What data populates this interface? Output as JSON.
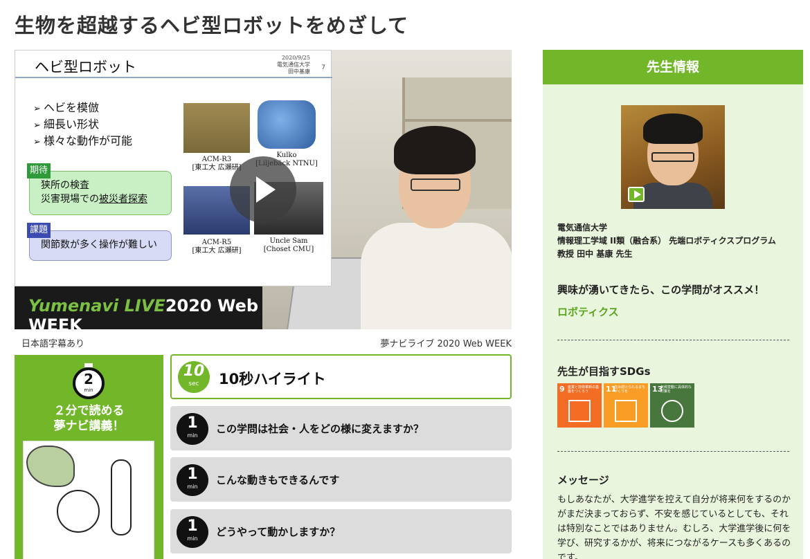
{
  "page": {
    "title": "生物を超越するヘビ型ロボットをめざして"
  },
  "video": {
    "slide": {
      "title": "ヘビ型ロボット",
      "date": "2020/9/25",
      "university": "電気通信大学",
      "author": "田中基康",
      "page_number": "7",
      "bullets": [
        "ヘビを模倣",
        "細長い形状",
        "様々な動作が可能"
      ],
      "expect_tag": "期待",
      "expect_lines": [
        "狭所の検査",
        "災害現場での",
        "被災者探索"
      ],
      "issue_tag": "課題",
      "issue_line": "関節数が多く操作が難しい",
      "robots": [
        {
          "name": "ACM-R3",
          "lab": "[東工大 広瀬研]"
        },
        {
          "name": "Kulko",
          "lab": "[Liljebäck NTNU]"
        },
        {
          "name": "ACM-R5",
          "lab": "[東工大 広瀬研]"
        },
        {
          "name": "Uncle Sam",
          "lab": "[Choset CMU]"
        }
      ]
    },
    "brand": {
      "prefix": "Yumenavi",
      "live": "LIVE",
      "year": "2020",
      "suffix": "Web WEEK"
    },
    "subtitle_note": "日本語字幕あり",
    "week_note": "夢ナビライブ 2020 Web WEEK"
  },
  "two_min": {
    "number": "2",
    "unit": "min",
    "line1": "２分で読める",
    "line2": "夢ナビ講義！"
  },
  "highlight": {
    "badge_number": "10",
    "badge_unit": "sec",
    "label": "10秒ハイライト"
  },
  "one_min_cards": [
    {
      "number": "1",
      "unit": "min",
      "label": "この学問は社会・人をどの様に変えますか？"
    },
    {
      "number": "1",
      "unit": "min",
      "label": "こんな動きもできるんです"
    },
    {
      "number": "1",
      "unit": "min",
      "label": "どうやって動かしますか？"
    }
  ],
  "sidebar": {
    "header": "先生情報",
    "university": "電気通信大学",
    "department": "情報理工学域 II類（融合系） 先端ロボティクスプログラム",
    "teacher": "教授 田中 基康 先生",
    "interest": "興味が湧いてきたら、この学問がオススメ！",
    "field": "ロボティクス",
    "sdgs_title": "先生が目指すSDGs",
    "sdgs": [
      {
        "number": "9",
        "text": "産業と技術革新の基盤をつくろう",
        "color": "#f36d25"
      },
      {
        "number": "11",
        "text": "住み続けられるまちづくりを",
        "color": "#f99d26"
      },
      {
        "number": "13",
        "text": "気候変動に具体的な対策を",
        "color": "#48773e"
      }
    ],
    "message_title": "メッセージ",
    "message": "もしあなたが、大学進学を控えて自分が将来何をするのかがまだ決まっておらず、不安を感じているとしても、それは特別なことではありません。むしろ、大学進学後に何を学び、研究するかが、将来につながるケースも多くあるのです。"
  },
  "colors": {
    "accent_green": "#72b72a",
    "card_gray": "#dcdcdc",
    "side_bg": "#eaf5dd"
  }
}
